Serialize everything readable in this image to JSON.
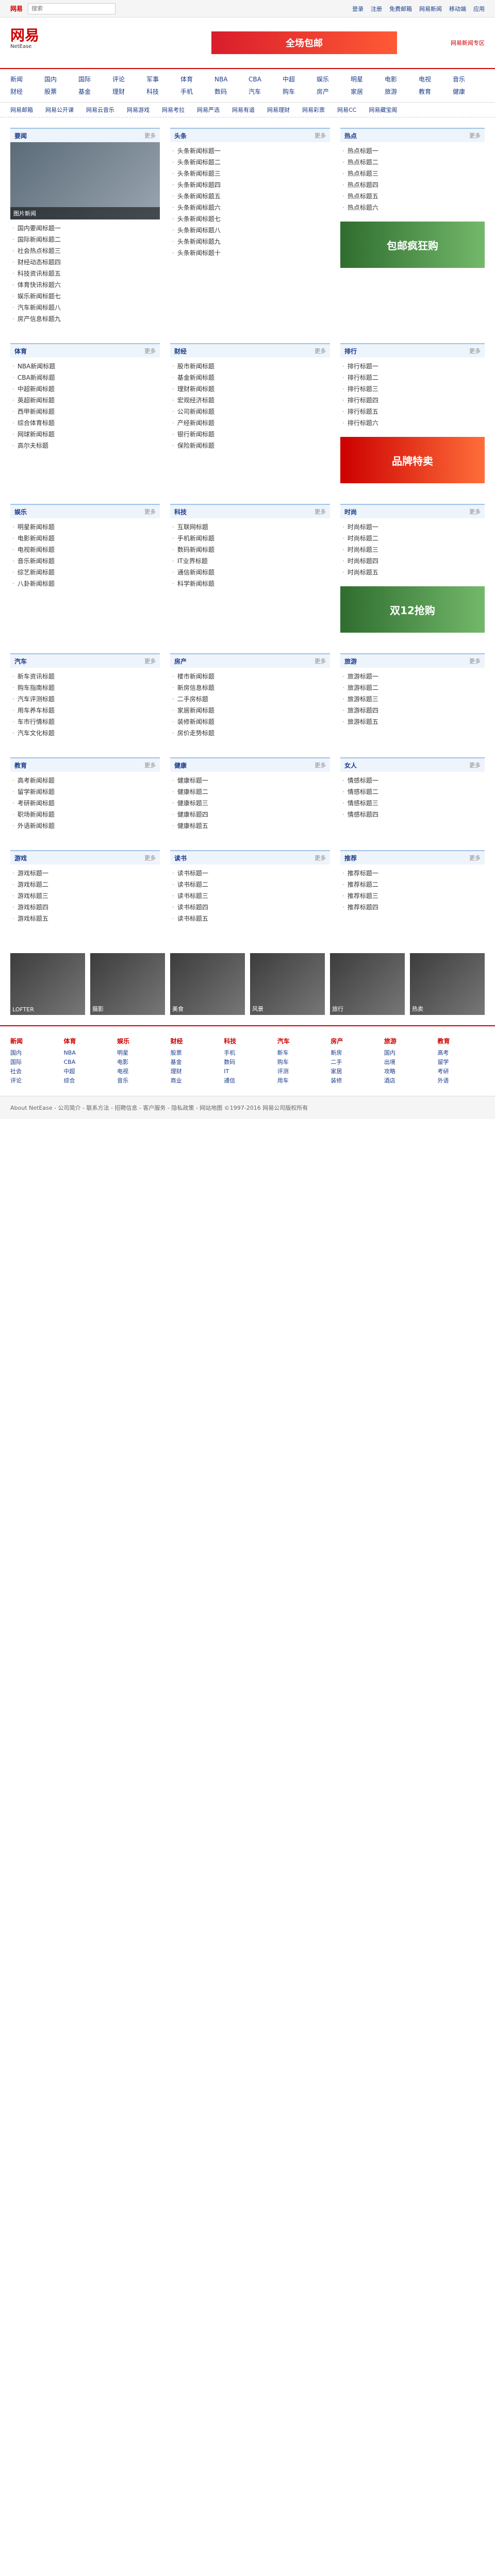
{
  "topbar": {
    "brand": "网易",
    "search_placeholder": "搜索",
    "links": [
      "登录",
      "注册",
      "免费邮箱",
      "网易新闻",
      "移动端",
      "应用"
    ]
  },
  "header": {
    "logo_cn": "网易",
    "logo_en": "NetEase",
    "banner": "全场包邮",
    "right_text": "网易新闻专区"
  },
  "nav": [
    "新闻",
    "国内",
    "国际",
    "评论",
    "军事",
    "体育",
    "NBA",
    "CBA",
    "中超",
    "娱乐",
    "明星",
    "电影",
    "电视",
    "音乐",
    "财经",
    "股票",
    "基金",
    "理财",
    "科技",
    "手机",
    "数码",
    "汽车",
    "购车",
    "房产",
    "家居",
    "旅游",
    "教育",
    "健康"
  ],
  "subnav": [
    "网易邮箱",
    "网易公开课",
    "网易云音乐",
    "网易游戏",
    "网易考拉",
    "网易严选",
    "网易有道",
    "网易理财",
    "网易彩票",
    "网易CC",
    "网易藏宝阁"
  ],
  "sections": [
    {
      "left": {
        "title": "要闻",
        "more": "更多",
        "caption": "图片新闻",
        "items": [
          "国内要闻标题一",
          "国际新闻标题二",
          "社会热点标题三",
          "财经动态标题四",
          "科技资讯标题五",
          "体育快讯标题六",
          "娱乐新闻标题七",
          "汽车新闻标题八",
          "房产信息标题九"
        ]
      },
      "mid": {
        "title": "头条",
        "more": "更多",
        "items": [
          "头条新闻标题一",
          "头条新闻标题二",
          "头条新闻标题三",
          "头条新闻标题四",
          "头条新闻标题五",
          "头条新闻标题六",
          "头条新闻标题七",
          "头条新闻标题八",
          "头条新闻标题九",
          "头条新闻标题十"
        ]
      },
      "right": {
        "title": "热点",
        "more": "更多",
        "items": [
          "热点标题一",
          "热点标题二",
          "热点标题三",
          "热点标题四",
          "热点标题五",
          "热点标题六"
        ]
      }
    },
    {
      "left": {
        "title": "体育",
        "more": "更多",
        "items": [
          "NBA新闻标题",
          "CBA新闻标题",
          "中超新闻标题",
          "英超新闻标题",
          "西甲新闻标题",
          "综合体育标题",
          "网球新闻标题",
          "高尔夫标题"
        ]
      },
      "mid": {
        "title": "财经",
        "more": "更多",
        "items": [
          "股市新闻标题",
          "基金新闻标题",
          "理财新闻标题",
          "宏观经济标题",
          "公司新闻标题",
          "产经新闻标题",
          "银行新闻标题",
          "保险新闻标题"
        ]
      },
      "right": {
        "title": "排行",
        "more": "更多",
        "items": [
          "排行标题一",
          "排行标题二",
          "排行标题三",
          "排行标题四",
          "排行标题五",
          "排行标题六"
        ]
      }
    },
    {
      "left": {
        "title": "娱乐",
        "more": "更多",
        "items": [
          "明星新闻标题",
          "电影新闻标题",
          "电视新闻标题",
          "音乐新闻标题",
          "综艺新闻标题",
          "八卦新闻标题"
        ]
      },
      "mid": {
        "title": "科技",
        "more": "更多",
        "items": [
          "互联网标题",
          "手机新闻标题",
          "数码新闻标题",
          "IT业界标题",
          "通信新闻标题",
          "科学新闻标题"
        ]
      },
      "right": {
        "title": "时尚",
        "more": "更多",
        "items": [
          "时尚标题一",
          "时尚标题二",
          "时尚标题三",
          "时尚标题四",
          "时尚标题五"
        ]
      }
    },
    {
      "left": {
        "title": "汽车",
        "more": "更多",
        "items": [
          "新车资讯标题",
          "购车指南标题",
          "汽车评测标题",
          "用车养车标题",
          "车市行情标题",
          "汽车文化标题"
        ]
      },
      "mid": {
        "title": "房产",
        "more": "更多",
        "items": [
          "楼市新闻标题",
          "新房信息标题",
          "二手房标题",
          "家居新闻标题",
          "装修新闻标题",
          "房价走势标题"
        ]
      },
      "right": {
        "title": "旅游",
        "more": "更多",
        "items": [
          "旅游标题一",
          "旅游标题二",
          "旅游标题三",
          "旅游标题四",
          "旅游标题五"
        ]
      }
    },
    {
      "left": {
        "title": "教育",
        "more": "更多",
        "items": [
          "高考新闻标题",
          "留学新闻标题",
          "考研新闻标题",
          "职场新闻标题",
          "外语新闻标题"
        ]
      },
      "mid": {
        "title": "健康",
        "more": "更多",
        "items": [
          "健康标题一",
          "健康标题二",
          "健康标题三",
          "健康标题四",
          "健康标题五"
        ]
      },
      "right": {
        "title": "女人",
        "more": "更多",
        "items": [
          "情感标题一",
          "情感标题二",
          "情感标题三",
          "情感标题四"
        ]
      }
    },
    {
      "left": {
        "title": "游戏",
        "more": "更多",
        "items": [
          "游戏标题一",
          "游戏标题二",
          "游戏标题三",
          "游戏标题四",
          "游戏标题五"
        ]
      },
      "mid": {
        "title": "读书",
        "more": "更多",
        "items": [
          "读书标题一",
          "读书标题二",
          "读书标题三",
          "读书标题四",
          "读书标题五"
        ]
      },
      "right": {
        "title": "推荐",
        "more": "更多",
        "items": [
          "推荐标题一",
          "推荐标题二",
          "推荐标题三",
          "推荐标题四"
        ]
      }
    }
  ],
  "ads": [
    "包邮疯狂购",
    "品牌特卖",
    "双12抢购"
  ],
  "footer_pics": [
    "LOFTER",
    "摄影",
    "美食",
    "风景",
    "旅行",
    "热卖"
  ],
  "sitemap": [
    {
      "h": "新闻",
      "items": [
        "国内",
        "国际",
        "社会",
        "评论"
      ]
    },
    {
      "h": "体育",
      "items": [
        "NBA",
        "CBA",
        "中超",
        "综合"
      ]
    },
    {
      "h": "娱乐",
      "items": [
        "明星",
        "电影",
        "电视",
        "音乐"
      ]
    },
    {
      "h": "财经",
      "items": [
        "股票",
        "基金",
        "理财",
        "商业"
      ]
    },
    {
      "h": "科技",
      "items": [
        "手机",
        "数码",
        "IT",
        "通信"
      ]
    },
    {
      "h": "汽车",
      "items": [
        "新车",
        "购车",
        "评测",
        "用车"
      ]
    },
    {
      "h": "房产",
      "items": [
        "新房",
        "二手",
        "家居",
        "装修"
      ]
    },
    {
      "h": "旅游",
      "items": [
        "国内",
        "出境",
        "攻略",
        "酒店"
      ]
    },
    {
      "h": "教育",
      "items": [
        "高考",
        "留学",
        "考研",
        "外语"
      ]
    }
  ],
  "bottom": "About NetEase - 公司简介 - 联系方法 - 招聘信息 - 客户服务 - 隐私政策 - 网站地图 ©1997-2016 网易公司版权所有"
}
